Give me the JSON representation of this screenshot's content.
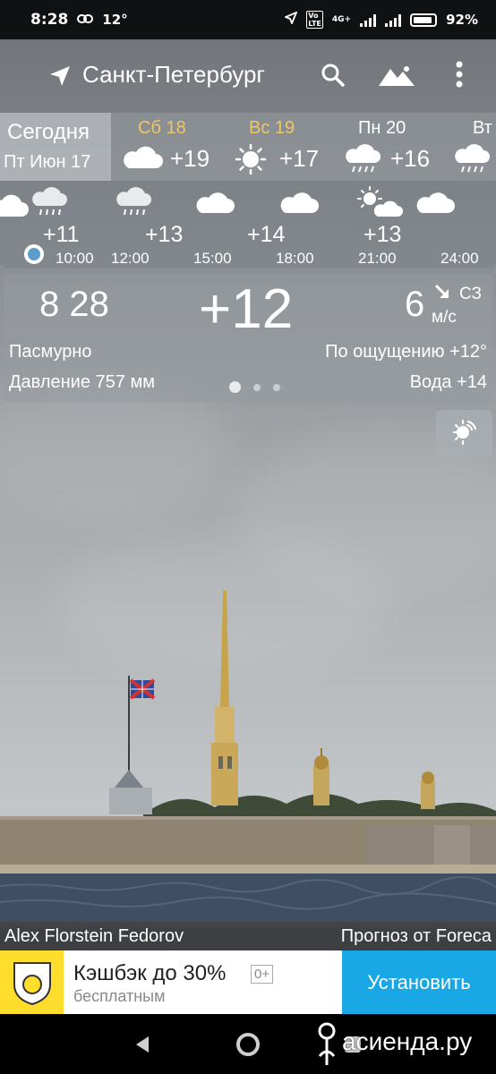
{
  "status_bar": {
    "time": "8:28",
    "temp": "12°",
    "battery": "92%",
    "battery_level": 0.92,
    "network": "4G+"
  },
  "toolbar": {
    "city": "Санкт-Петербург",
    "icons": [
      "location-arrow-icon",
      "search-icon",
      "mountains-icon",
      "more-vert-icon"
    ]
  },
  "daily": {
    "today_label": "Сегодня",
    "today_date": "Пт Июн 17",
    "days": [
      {
        "name": "Сб 18",
        "temp": "+19",
        "icon": "cloud-icon",
        "weekend": true
      },
      {
        "name": "Вс 19",
        "temp": "+17",
        "icon": "sun-icon",
        "weekend": true
      },
      {
        "name": "Пн 20",
        "temp": "+16",
        "icon": "rain-icon",
        "weekend": false
      },
      {
        "name": "Вт",
        "temp": "",
        "icon": "rain-icon",
        "weekend": false
      }
    ]
  },
  "hourly": {
    "icons": [
      "cloud-icon",
      "rain-cloud-icon",
      "rain-cloud-icon",
      "cloud-icon",
      "cloud-icon",
      "partly-cloudy-icon",
      "cloud-icon"
    ],
    "temps": [
      "+11",
      "+13",
      "+14",
      "+13"
    ],
    "times": [
      "10:00",
      "12:00",
      "15:00",
      "18:00",
      "21:00",
      "24:00"
    ]
  },
  "current": {
    "time": "8 28",
    "temp": "+12",
    "wind_speed": "6",
    "wind_dir": "СЗ",
    "wind_unit": "м/с",
    "condition": "Пасмурно",
    "pressure": "Давление 757 мм",
    "feels_like": "По ощущению +12°",
    "water": "Вода +14",
    "page_dots": 3,
    "active_dot": 0
  },
  "credits": {
    "photo_author": "Alex Florstein Fedorov",
    "forecast_source": "Прогноз от Foreca"
  },
  "ad": {
    "title": "Кэшбэк до 30%",
    "age_badge": "0+",
    "subtitle": "бесплатным",
    "button": "Установить",
    "button_color": "#1aa7e6",
    "logo_color": "#ffdd2d"
  },
  "watermark": "асиенда.ру",
  "colors": {
    "weekend_day": "#f0c566",
    "now_marker": "#5a9ccc"
  }
}
